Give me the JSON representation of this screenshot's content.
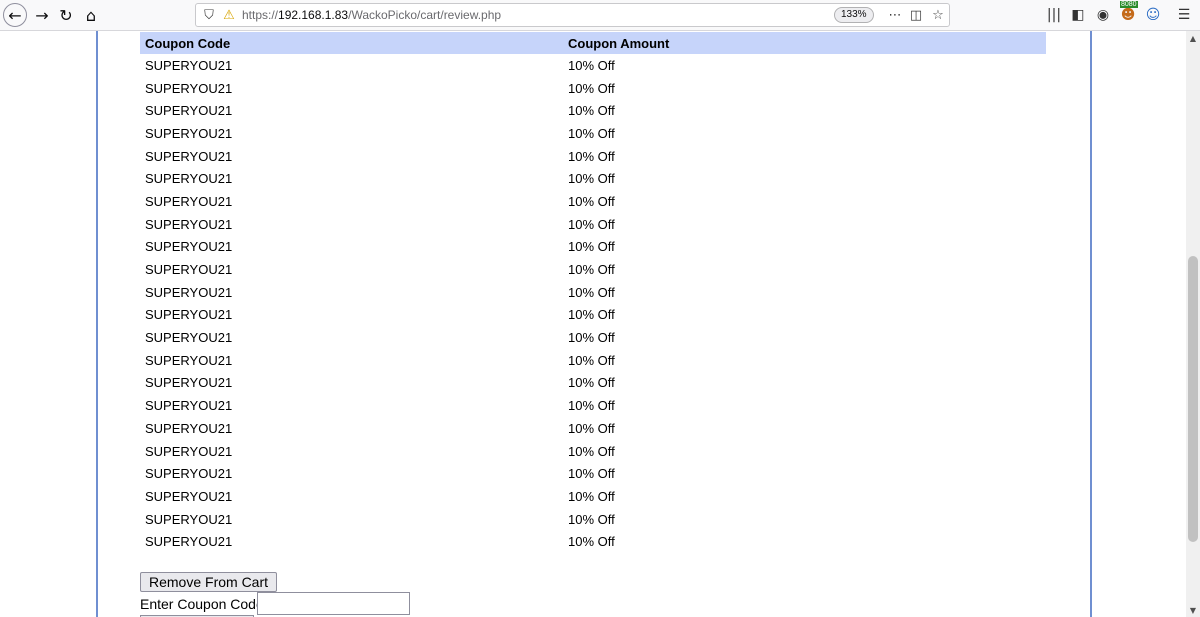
{
  "browser": {
    "url_prefix": "https://",
    "url_host": "192.168.1.83",
    "url_path": "/WackoPicko/cart/review.php",
    "zoom": "133%",
    "ext_badge": "8080"
  },
  "table": {
    "headers": [
      "Coupon Code",
      "Coupon Amount"
    ],
    "rows": [
      [
        "SUPERYOU21",
        "10% Off"
      ],
      [
        "SUPERYOU21",
        "10% Off"
      ],
      [
        "SUPERYOU21",
        "10% Off"
      ],
      [
        "SUPERYOU21",
        "10% Off"
      ],
      [
        "SUPERYOU21",
        "10% Off"
      ],
      [
        "SUPERYOU21",
        "10% Off"
      ],
      [
        "SUPERYOU21",
        "10% Off"
      ],
      [
        "SUPERYOU21",
        "10% Off"
      ],
      [
        "SUPERYOU21",
        "10% Off"
      ],
      [
        "SUPERYOU21",
        "10% Off"
      ],
      [
        "SUPERYOU21",
        "10% Off"
      ],
      [
        "SUPERYOU21",
        "10% Off"
      ],
      [
        "SUPERYOU21",
        "10% Off"
      ],
      [
        "SUPERYOU21",
        "10% Off"
      ],
      [
        "SUPERYOU21",
        "10% Off"
      ],
      [
        "SUPERYOU21",
        "10% Off"
      ],
      [
        "SUPERYOU21",
        "10% Off"
      ],
      [
        "SUPERYOU21",
        "10% Off"
      ],
      [
        "SUPERYOU21",
        "10% Off"
      ],
      [
        "SUPERYOU21",
        "10% Off"
      ],
      [
        "SUPERYOU21",
        "10% Off"
      ],
      [
        "SUPERYOU21",
        "10% Off"
      ]
    ]
  },
  "form": {
    "remove_label": "Remove From Cart",
    "coupon_label": "Enter Coupon Code:",
    "coupon_value": ""
  },
  "colors": {
    "header_bg": "#c6d4fa",
    "border_accent": "#6f8fd1"
  }
}
